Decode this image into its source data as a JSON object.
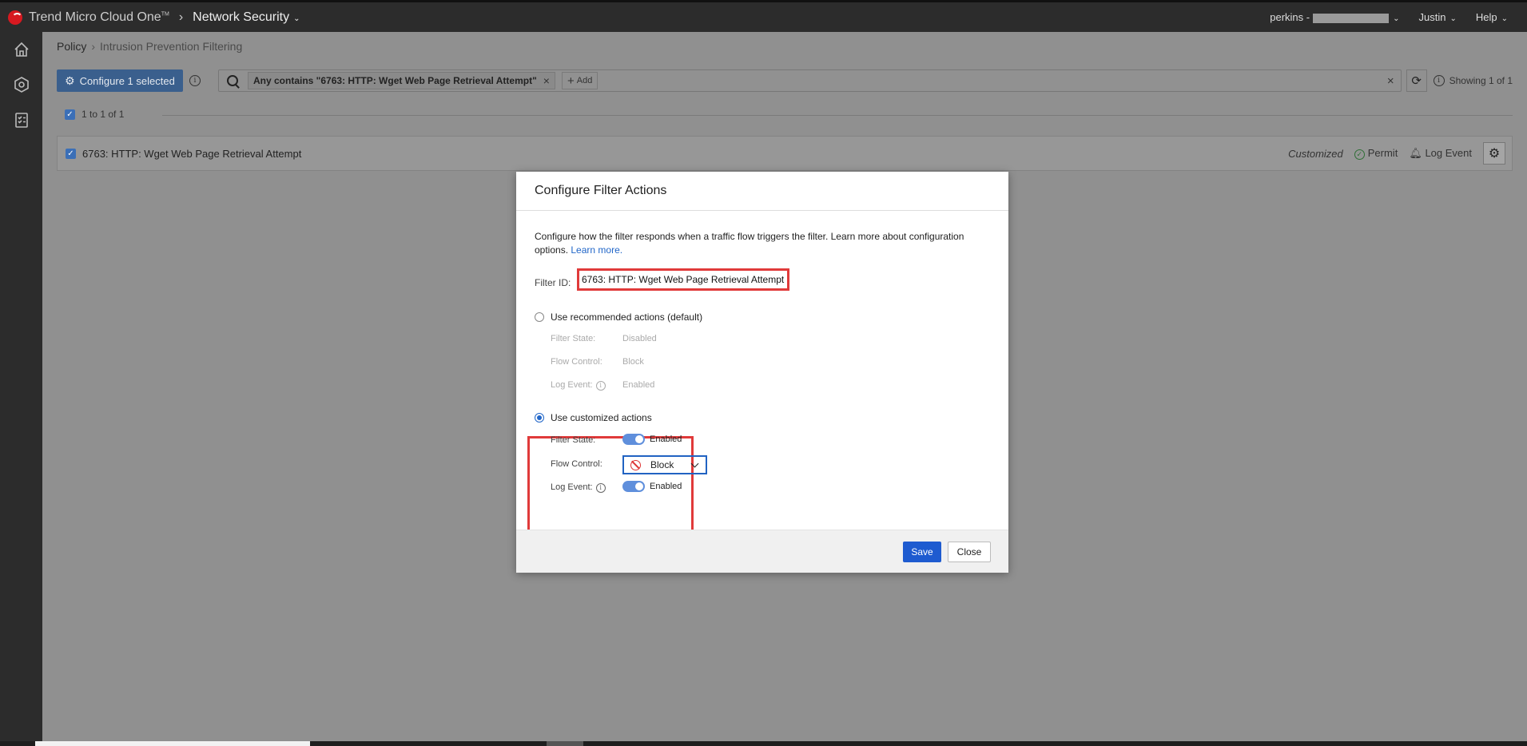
{
  "topbar": {
    "brand": "Trend Micro Cloud One",
    "brand_tm": "TM",
    "product": "Network Security",
    "account_label": "perkins -",
    "user": "Justin",
    "help": "Help"
  },
  "breadcrumb": {
    "root": "Policy",
    "sep": "›",
    "current": "Intrusion Prevention Filtering"
  },
  "toolbar": {
    "configure_label": "Configure 1 selected",
    "filter_chip": "Any contains \"6763: HTTP: Wget Web Page Retrieval Attempt\"",
    "add_label": "Add",
    "showing": "Showing 1 of 1"
  },
  "selection": {
    "range": "1 to 1 of 1"
  },
  "filter_row": {
    "name": "6763: HTTP: Wget Web Page Retrieval Attempt",
    "status": "Customized",
    "action": "Permit",
    "log": "Log Event"
  },
  "modal": {
    "title": "Configure Filter Actions",
    "description": "Configure how the filter responds when a traffic flow triggers the filter. Learn more about configuration options.",
    "learn_more": "Learn more.",
    "filter_id_label": "Filter ID:",
    "filter_id_value": "6763: HTTP: Wget Web Page Retrieval Attempt",
    "recommended": {
      "label": "Use recommended actions (default)",
      "filter_state_label": "Filter State:",
      "filter_state_value": "Disabled",
      "flow_control_label": "Flow Control:",
      "flow_control_value": "Block",
      "log_event_label": "Log Event:",
      "log_event_value": "Enabled"
    },
    "customized": {
      "label": "Use customized actions",
      "filter_state_label": "Filter State:",
      "filter_state_value": "Enabled",
      "flow_control_label": "Flow Control:",
      "flow_control_value": "Block",
      "log_event_label": "Log Event:",
      "log_event_value": "Enabled"
    },
    "save": "Save",
    "close": "Close"
  }
}
